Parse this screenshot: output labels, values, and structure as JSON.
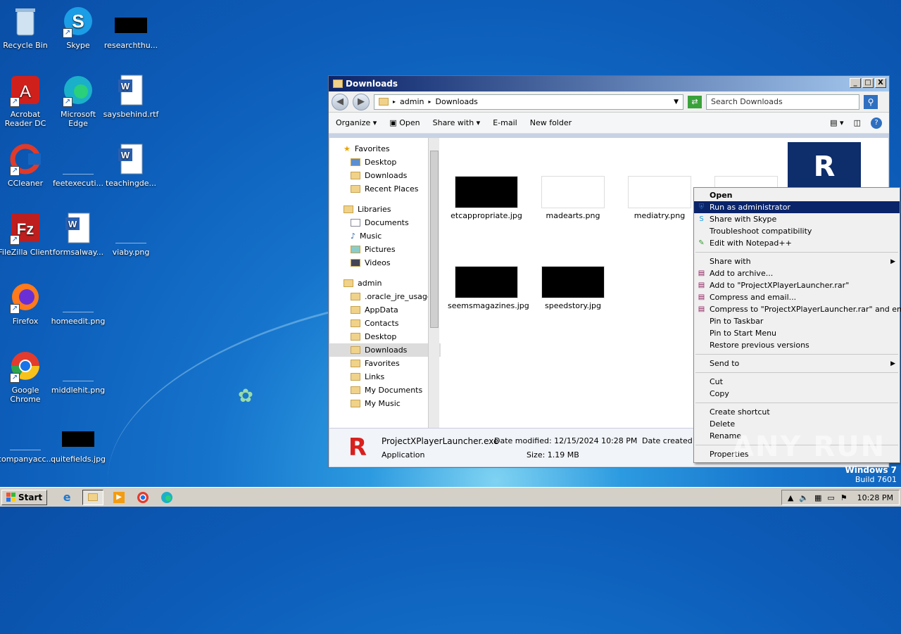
{
  "desktop": {
    "icons": [
      {
        "label": "Recycle Bin",
        "icon": "recycle-bin-icon"
      },
      {
        "label": "Skype",
        "icon": "skype-icon"
      },
      {
        "label": "researchthu...",
        "icon": "image-file-icon"
      },
      {
        "label": "Acrobat Reader DC",
        "icon": "acrobat-icon"
      },
      {
        "label": "Microsoft Edge",
        "icon": "edge-icon"
      },
      {
        "label": "saysbehind.rtf",
        "icon": "word-doc-icon"
      },
      {
        "label": "CCleaner",
        "icon": "ccleaner-icon"
      },
      {
        "label": "feetexecuti...",
        "icon": "file-icon"
      },
      {
        "label": "teachingde...",
        "icon": "word-doc-icon"
      },
      {
        "label": "FileZilla Client",
        "icon": "filezilla-icon"
      },
      {
        "label": "formsalway...",
        "icon": "word-doc-icon"
      },
      {
        "label": "viaby.png",
        "icon": "image-file-icon"
      },
      {
        "label": "Firefox",
        "icon": "firefox-icon"
      },
      {
        "label": "homeedit.png",
        "icon": "image-file-icon"
      },
      {
        "label": "Google Chrome",
        "icon": "chrome-icon"
      },
      {
        "label": "middlehit.png",
        "icon": "image-file-icon"
      },
      {
        "label": "companyacc...",
        "icon": "file-icon"
      },
      {
        "label": "quitefields.jpg",
        "icon": "image-file-icon"
      }
    ]
  },
  "window": {
    "title": "Downloads",
    "controls": {
      "minimize": "_",
      "maximize": "□",
      "close": "X"
    },
    "address": {
      "segment1": "admin",
      "segment2": "Downloads"
    },
    "search_placeholder": "Search Downloads",
    "toolbar": {
      "organize": "Organize",
      "open": "Open",
      "share_with": "Share with",
      "email": "E-mail",
      "new_folder": "New folder"
    },
    "nav": {
      "favorites_header": "Favorites",
      "favorites": [
        "Desktop",
        "Downloads",
        "Recent Places"
      ],
      "libraries_header": "Libraries",
      "libraries": [
        "Documents",
        "Music",
        "Pictures",
        "Videos"
      ],
      "user_header": "admin",
      "user_items": [
        ".oracle_jre_usage",
        "AppData",
        "Contacts",
        "Desktop",
        "Downloads",
        "Favorites",
        "Links",
        "My Documents",
        "My Music"
      ]
    },
    "files": [
      {
        "name": "etcappropriate.jpg",
        "dark": true
      },
      {
        "name": "madearts.png",
        "dark": false
      },
      {
        "name": "mediatry.png",
        "dark": false
      },
      {
        "name": "seemsmagazines.jpg",
        "dark": true
      },
      {
        "name": "speedstory.jpg",
        "dark": true
      }
    ],
    "details": {
      "filename": "ProjectXPlayerLauncher.exe",
      "type": "Application",
      "modified_label": "Date modified:",
      "modified_value": "12/15/2024 10:28 PM",
      "size_label": "Size:",
      "size_value": "1.19 MB",
      "created_label": "Date created:"
    }
  },
  "context_menu": {
    "items": [
      {
        "label": "Open",
        "bold": true
      },
      {
        "label": "Run as administrator",
        "selected": true,
        "icon": "shield-icon"
      },
      {
        "label": "Share with Skype",
        "icon": "skype-icon"
      },
      {
        "label": "Troubleshoot compatibility"
      },
      {
        "label": "Edit with Notepad++",
        "icon": "notepad-icon"
      },
      {
        "sep": true
      },
      {
        "label": "Share with",
        "submenu": true
      },
      {
        "label": "Add to archive...",
        "icon": "winrar-icon"
      },
      {
        "label": "Add to \"ProjectXPlayerLauncher.rar\"",
        "icon": "winrar-icon"
      },
      {
        "label": "Compress and email...",
        "icon": "winrar-icon"
      },
      {
        "label": "Compress to \"ProjectXPlayerLauncher.rar\" and email",
        "icon": "winrar-icon"
      },
      {
        "label": "Pin to Taskbar"
      },
      {
        "label": "Pin to Start Menu"
      },
      {
        "label": "Restore previous versions"
      },
      {
        "sep": true
      },
      {
        "label": "Send to",
        "submenu": true
      },
      {
        "sep": true
      },
      {
        "label": "Cut"
      },
      {
        "label": "Copy"
      },
      {
        "sep": true
      },
      {
        "label": "Create shortcut"
      },
      {
        "label": "Delete"
      },
      {
        "label": "Rename"
      },
      {
        "sep": true
      },
      {
        "label": "Properties"
      }
    ]
  },
  "taskbar": {
    "start": "Start",
    "clock": "10:28 PM"
  },
  "os_info": {
    "name": "Windows 7",
    "build": "Build 7601"
  },
  "watermark": "ANY RUN"
}
